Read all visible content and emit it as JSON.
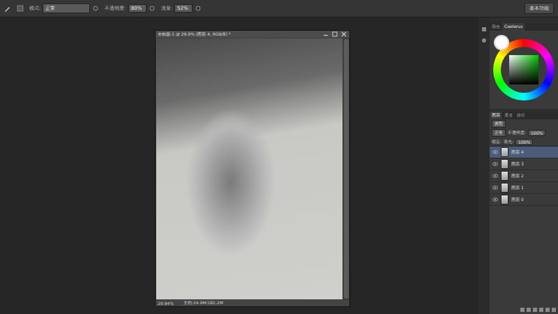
{
  "options_bar": {
    "fields": [
      {
        "label": "模式:",
        "value": "正常"
      },
      {
        "label": "不透明度:",
        "value": "80%"
      },
      {
        "label": "流量:",
        "value": "52%"
      }
    ],
    "workspace": "基本功能"
  },
  "document": {
    "title": "未标题-1 @ 29.9% (图层 4, RGB/8) *",
    "zoom": "29.94%",
    "doc_size": "文档:24.9M/182.2M"
  },
  "color_panel": {
    "tabs": [
      {
        "label": "颜色",
        "selected": false
      },
      {
        "label": "Coolorus",
        "selected": true
      }
    ]
  },
  "layers_panel": {
    "tabs": [
      {
        "label": "图层",
        "selected": true
      },
      {
        "label": "通道",
        "selected": false
      },
      {
        "label": "路径",
        "selected": false
      }
    ],
    "filter": "类型",
    "blend_mode": "正常",
    "opacity_label": "不透明度:",
    "opacity": "100%",
    "lock_label": "锁定:",
    "fill_label": "填充:",
    "fill": "100%",
    "layers": [
      {
        "name": "图层 4",
        "selected": true,
        "visible": true
      },
      {
        "name": "图层 3",
        "selected": false,
        "visible": true
      },
      {
        "name": "图层 2",
        "selected": false,
        "visible": true
      },
      {
        "name": "图层 1",
        "selected": false,
        "visible": true
      },
      {
        "name": "图层 0",
        "selected": false,
        "visible": true
      }
    ]
  }
}
